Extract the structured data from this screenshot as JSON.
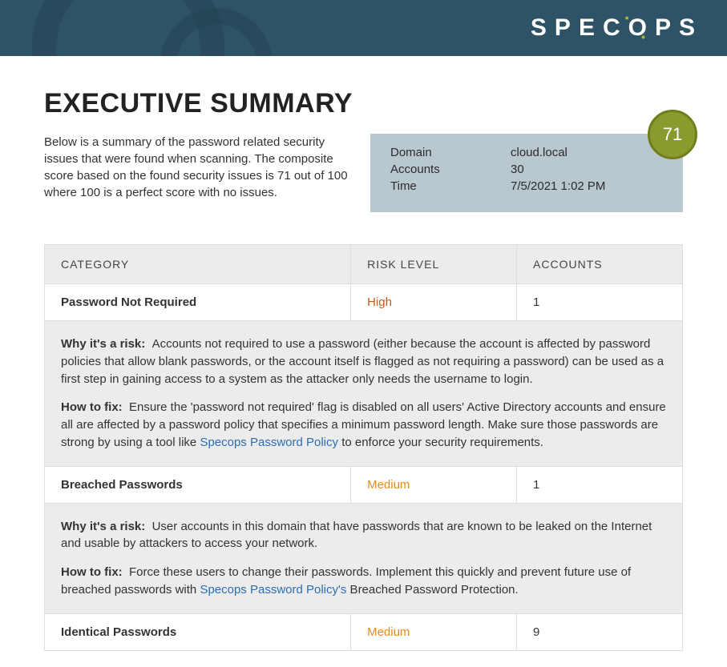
{
  "brand": "SPECOPS",
  "title": "EXECUTIVE SUMMARY",
  "intro": "Below is a summary of the password related security issues that were found when scanning. The composite score based on the found security issues is 71 out of 100 where 100 is a perfect score with no issues.",
  "info": {
    "domain_label": "Domain",
    "domain_value": "cloud.local",
    "accounts_label": "Accounts",
    "accounts_value": "30",
    "time_label": "Time",
    "time_value": "7/5/2021 1:02 PM",
    "score": "71"
  },
  "table": {
    "headers": {
      "category": "CATEGORY",
      "risk": "RISK LEVEL",
      "accounts": "ACCOUNTS"
    },
    "rows": [
      {
        "category": "Password Not Required",
        "risk": "High",
        "risk_class": "risk-high",
        "accounts": "1",
        "why_label": "Why it's a risk:",
        "why_text": "Accounts not required to use a password (either because the account is affected by password policies that allow blank passwords, or the account itself is flagged as not requiring a password) can be used as a first step in gaining access to a system as the attacker only needs the username to login.",
        "fix_label": "How to fix:",
        "fix_pre": "Ensure the 'password not required' flag is disabled on all users' Active Directory accounts and ensure all are affected by a password policy that specifies a minimum password length. Make sure those passwords are strong by using a tool like ",
        "fix_link": "Specops Password Policy",
        "fix_post": " to enforce your security requirements."
      },
      {
        "category": "Breached Passwords",
        "risk": "Medium",
        "risk_class": "risk-medium",
        "accounts": "1",
        "why_label": "Why it's a risk:",
        "why_text": "User accounts in this domain that have passwords that are known to be leaked on the Internet and usable by attackers to access your network.",
        "fix_label": "How to fix:",
        "fix_pre": "Force these users to change their passwords. Implement this quickly and prevent future use of breached passwords with ",
        "fix_link": "Specops Password Policy's",
        "fix_post": " Breached Password Protection."
      },
      {
        "category": "Identical Passwords",
        "risk": "Medium",
        "risk_class": "risk-medium",
        "accounts": "9"
      }
    ]
  }
}
